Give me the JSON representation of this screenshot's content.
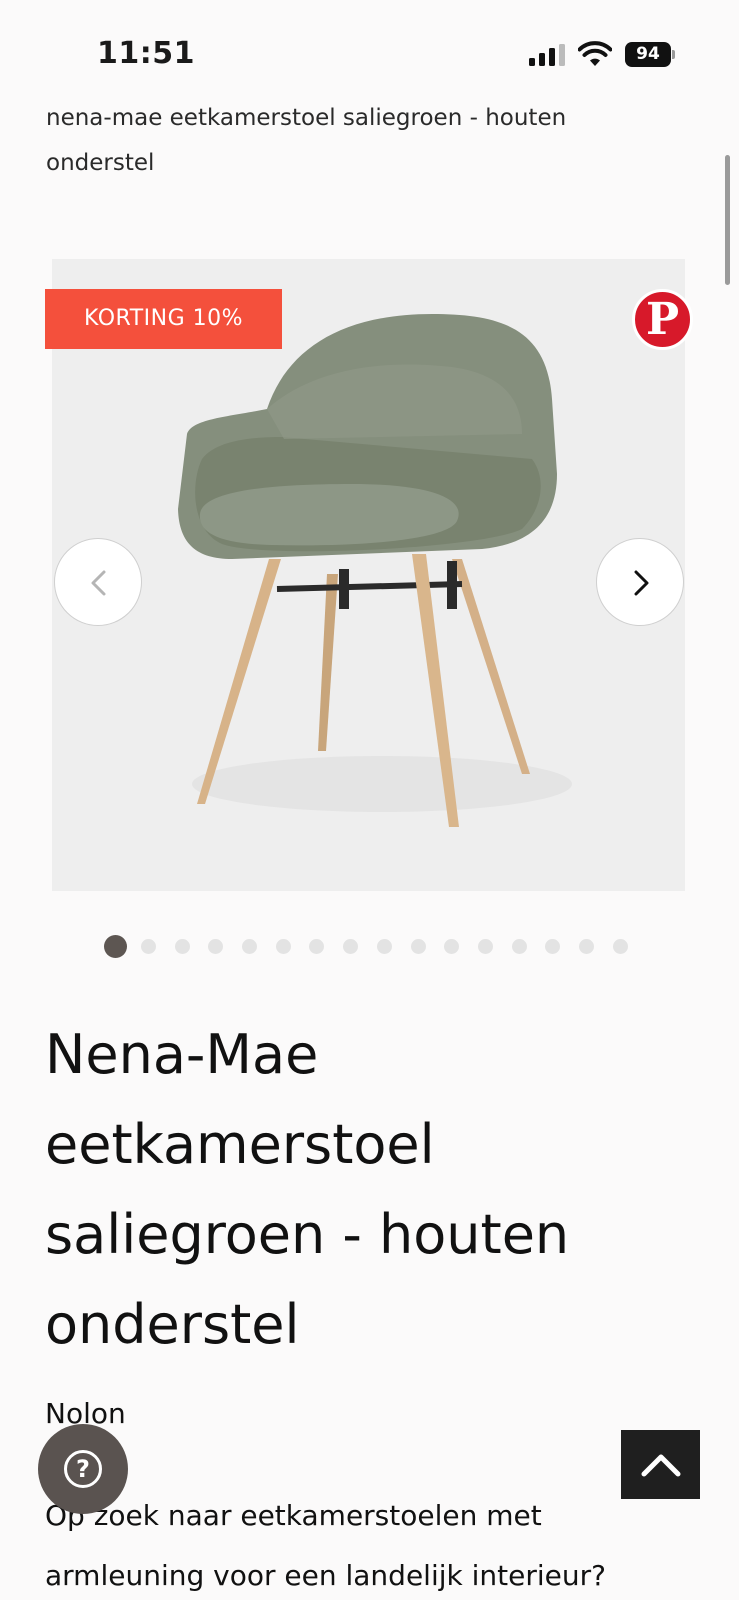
{
  "status_bar": {
    "time": "11:51",
    "battery": "94"
  },
  "breadcrumb": "nena-mae eetkamerstoel saliegroen - houten onderstel",
  "gallery": {
    "badge": "KORTING 10%",
    "pinterest_icon": "pinterest-icon",
    "prev_icon": "chevron-left-icon",
    "next_icon": "chevron-right-icon",
    "image_count": 16,
    "active_index": 0
  },
  "product": {
    "title": "Nena-Mae eetkamerstoel saliegroen - houten onderstel",
    "brand": "Nolon",
    "description": "Op zoek naar eetkamerstoelen met armleuning voor een landelijk interieur?"
  },
  "floating": {
    "help_icon": "help-icon",
    "help_glyph": "?",
    "top_icon": "arrow-up-icon"
  },
  "colors": {
    "badge": "#f4503c",
    "pinterest": "#d7192a",
    "dot_active": "#5d5652",
    "help_button": "#5a5350",
    "top_button": "#1f1f1f"
  }
}
